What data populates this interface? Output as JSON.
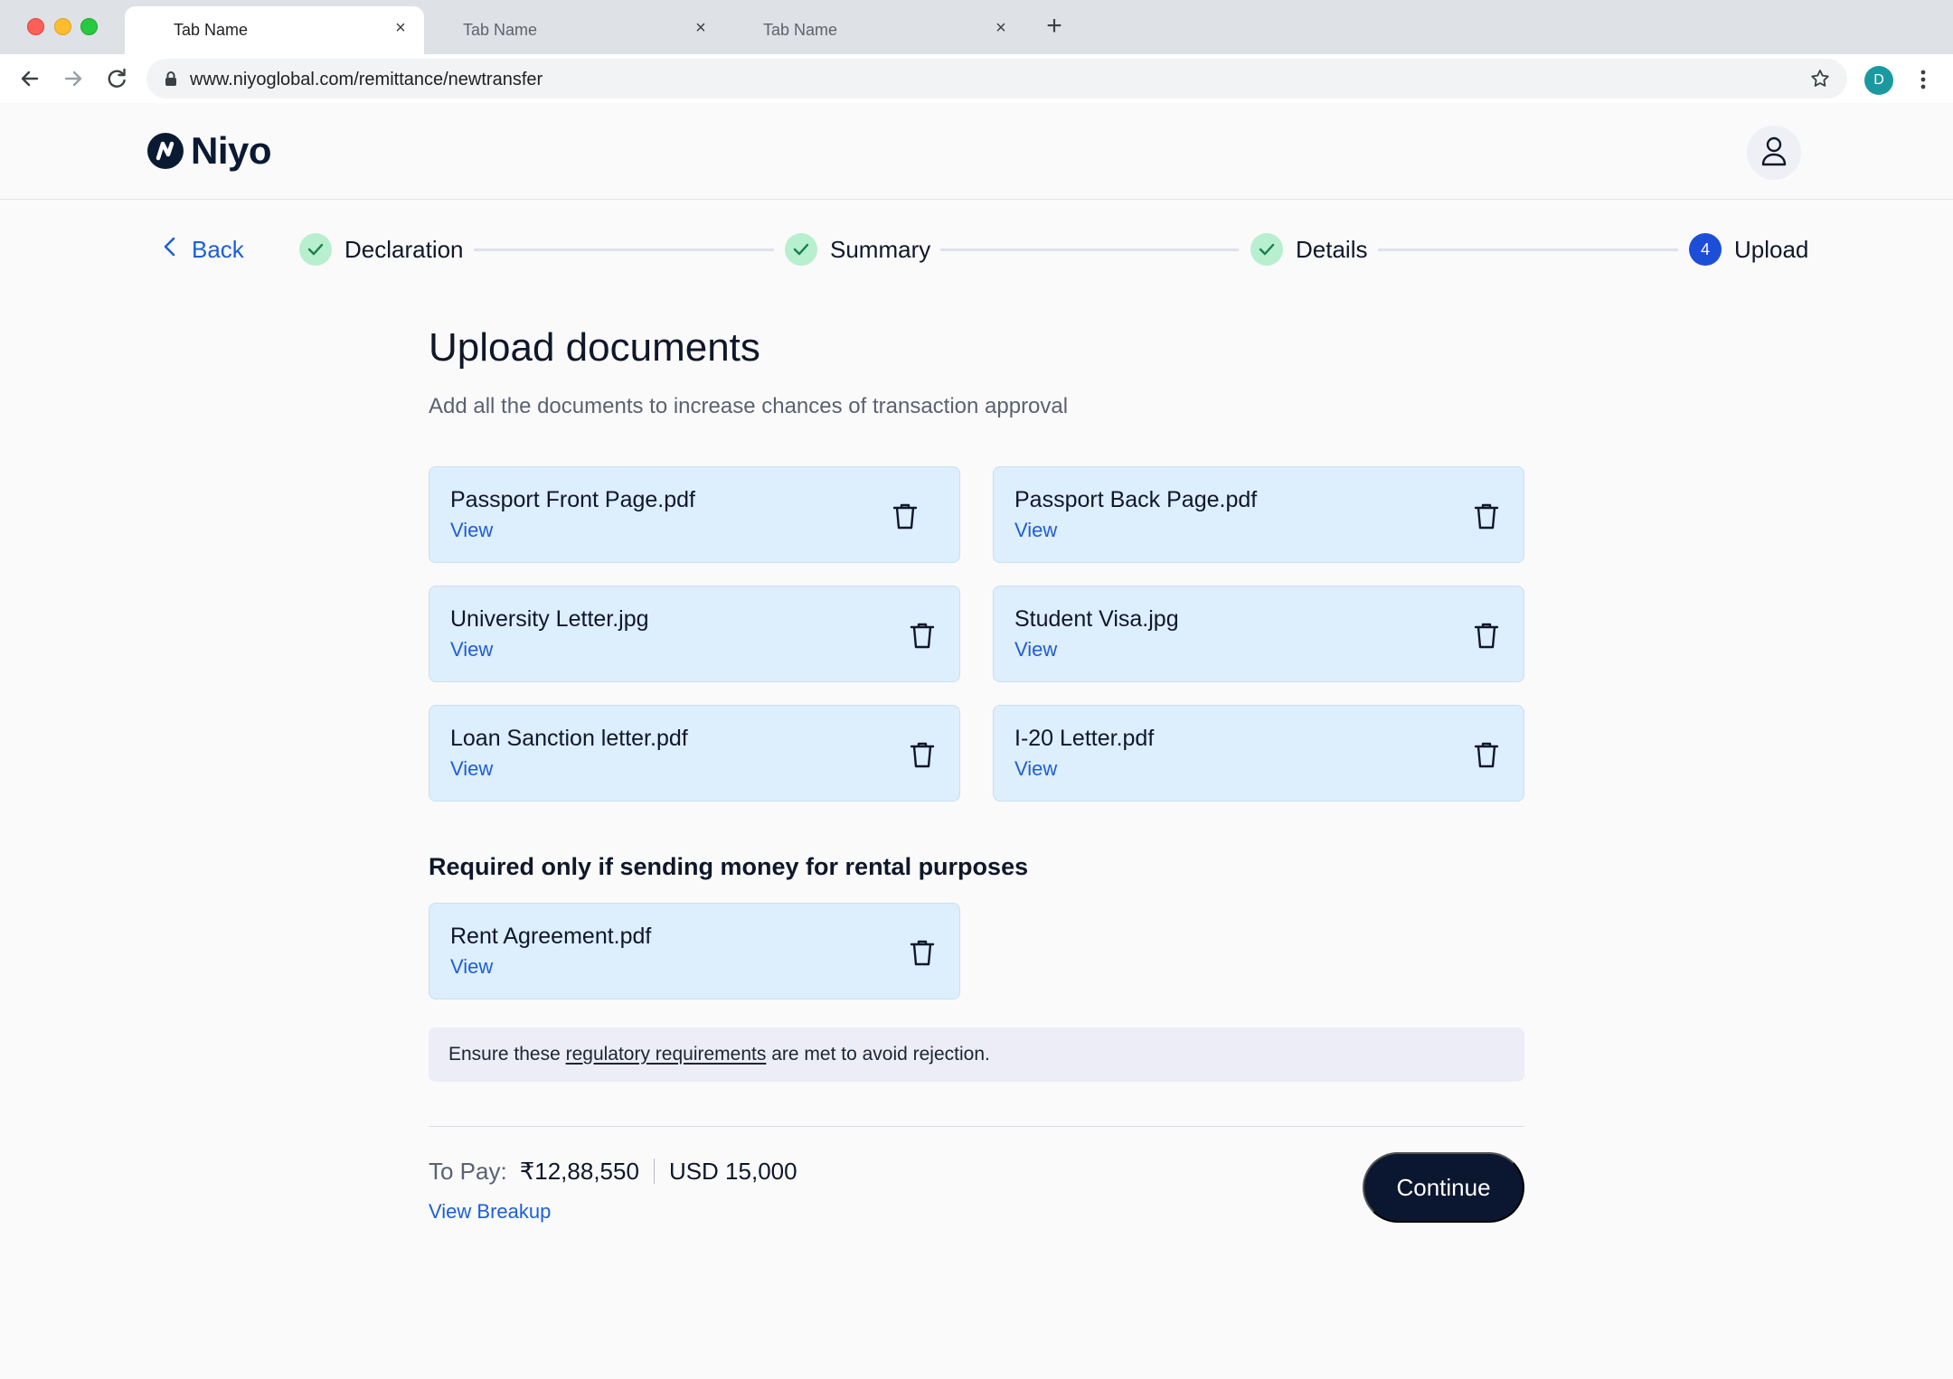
{
  "browser": {
    "tabs": [
      {
        "label": "Tab Name",
        "active": true
      },
      {
        "label": "Tab Name",
        "active": false
      },
      {
        "label": "Tab Name",
        "active": false
      }
    ],
    "url": "www.niyoglobal.com/remittance/newtransfer",
    "profile_initial": "D"
  },
  "header": {
    "brand": "Niyo"
  },
  "stepper": {
    "back_label": "Back",
    "steps": [
      {
        "label": "Declaration",
        "status": "complete"
      },
      {
        "label": "Summary",
        "status": "complete"
      },
      {
        "label": "Details",
        "status": "complete"
      },
      {
        "label": "Upload",
        "status": "current",
        "number": "4"
      }
    ]
  },
  "page": {
    "title": "Upload documents",
    "subtitle": "Add all the documents to increase chances of transaction approval"
  },
  "documents": [
    {
      "name": "Passport Front Page.pdf",
      "view_label": "View"
    },
    {
      "name": "Passport Back Page.pdf",
      "view_label": "View"
    },
    {
      "name": "University Letter.jpg",
      "view_label": "View"
    },
    {
      "name": "Student Visa.jpg",
      "view_label": "View"
    },
    {
      "name": "Loan Sanction letter.pdf",
      "view_label": "View"
    },
    {
      "name": "I-20 Letter.pdf",
      "view_label": "View"
    }
  ],
  "rental": {
    "heading": "Required only if sending money for rental purposes",
    "documents": [
      {
        "name": "Rent Agreement.pdf",
        "view_label": "View"
      }
    ]
  },
  "notice": {
    "prefix": "Ensure these ",
    "link": "regulatory requirements",
    "suffix": " are met to avoid rejection."
  },
  "footer": {
    "pay_label": "To Pay:",
    "amount_inr": "₹12,88,550",
    "amount_usd": "USD 15,000",
    "breakup_label": "View Breakup",
    "continue_label": "Continue"
  },
  "colors": {
    "accent": "#1d5ed8",
    "card_bg": "#ddeefc",
    "step_complete": "#b7efcf",
    "primary_button": "#0b1730"
  }
}
